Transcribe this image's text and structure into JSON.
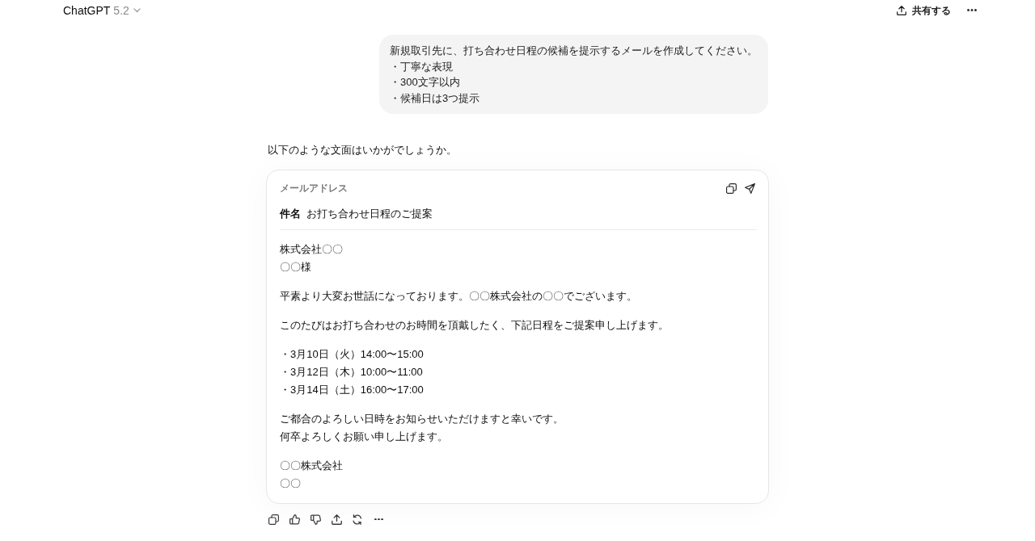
{
  "header": {
    "title": "ChatGPT",
    "version": "5.2",
    "share_label": "共有する"
  },
  "user_message": {
    "lines": [
      "新規取引先に、打ち合わせ日程の候補を提示するメールを作成してください。",
      "・丁寧な表現",
      "・300文字以内",
      "・候補日は3つ提示"
    ]
  },
  "assistant_message": {
    "intro": "以下のような文面はいかがでしょうか。",
    "email": {
      "address_label": "メールアドレス",
      "subject_label": "件名",
      "subject": "お打ち合わせ日程のご提案",
      "body": [
        {
          "lines": [
            "株式会社〇〇",
            "〇〇様"
          ]
        },
        {
          "lines": [
            "平素より大変お世話になっております。〇〇株式会社の〇〇でございます。"
          ]
        },
        {
          "lines": [
            "このたびはお打ち合わせのお時間を頂戴したく、下記日程をご提案申し上げます。"
          ]
        },
        {
          "lines": [
            "・3月10日（火）14:00〜15:00",
            "・3月12日（木）10:00〜11:00",
            "・3月14日（土）16:00〜17:00"
          ]
        },
        {
          "lines": [
            "ご都合のよろしい日時をお知らせいただけますと幸いです。",
            "何卒よろしくお願い申し上げます。"
          ]
        },
        {
          "lines": [
            "〇〇株式会社",
            "〇〇"
          ]
        }
      ]
    }
  }
}
